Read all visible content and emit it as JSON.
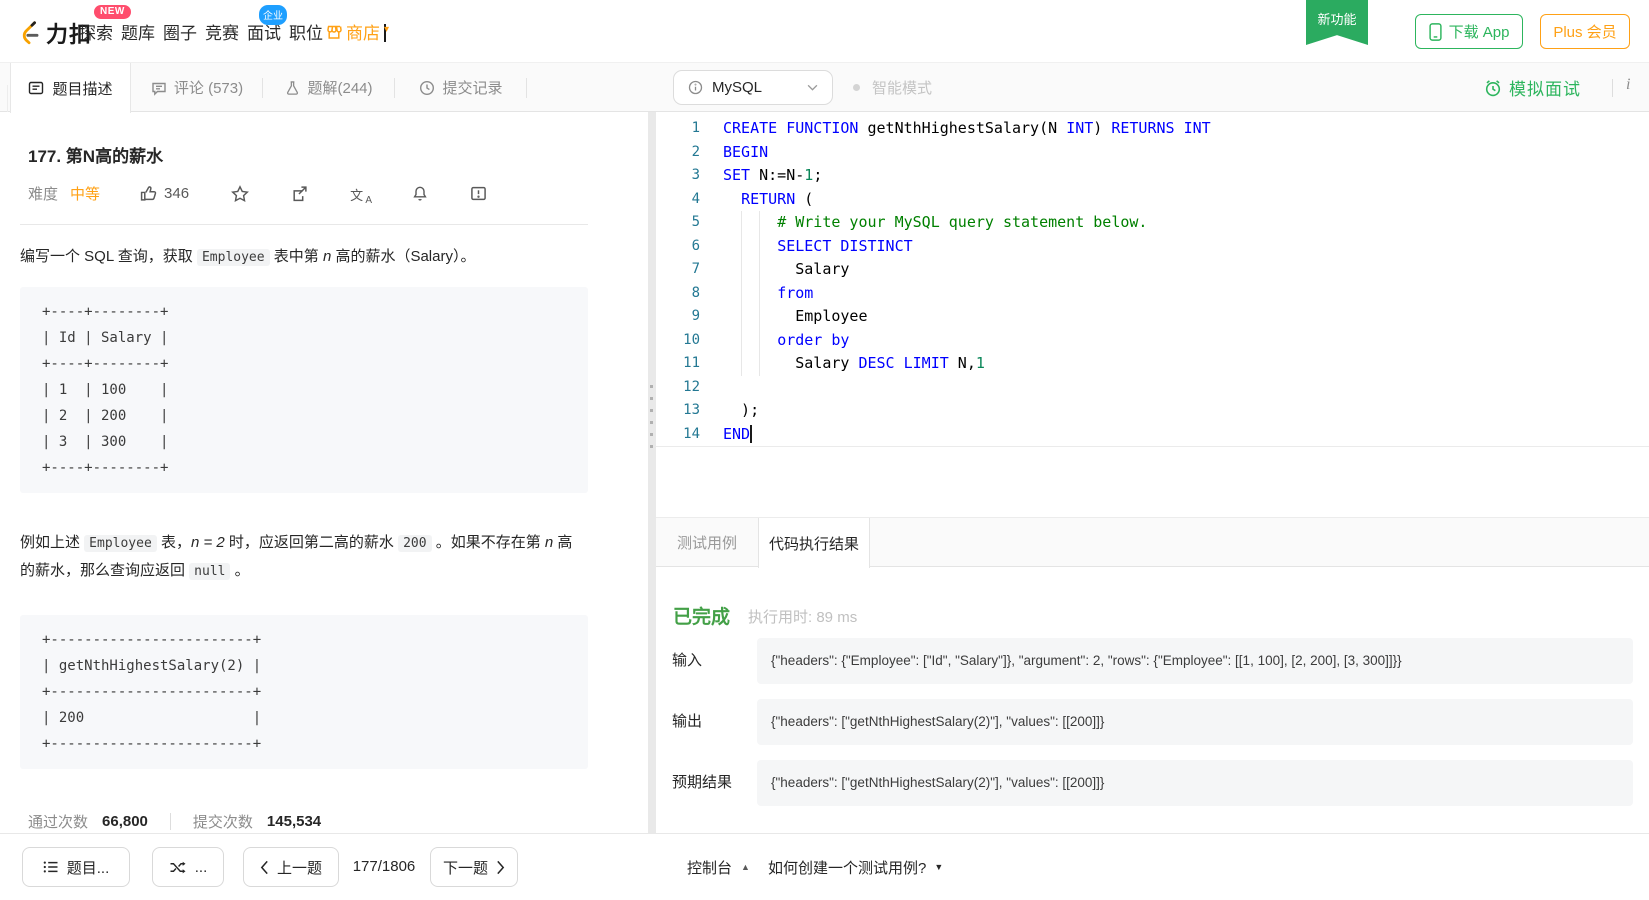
{
  "navbar": {
    "logo": "力扣",
    "items": [
      "探索",
      "题库",
      "圈子",
      "竞赛",
      "面试",
      "职位"
    ],
    "store": "商店",
    "new_badge": "NEW",
    "enterprise_badge": "企业",
    "ribbon": "新功能",
    "download_app": "下载 App",
    "plus_member": "Plus 会员"
  },
  "tabstrip": {
    "description_tab": "题目描述",
    "comments_tab": "评论 (573)",
    "solutions_tab": "题解(244)",
    "submissions_tab": "提交记录",
    "language": "MySQL",
    "smart_mode": "智能模式",
    "mock_interview": "模拟面试",
    "info_i": "i"
  },
  "problem": {
    "title": "177. 第N高的薪水",
    "difficulty_label": "难度",
    "difficulty": "中等",
    "likes": "346",
    "para1": [
      {
        "t": "编写一个 SQL 查询，获取 "
      },
      {
        "t": "Employee",
        "s": "code"
      },
      {
        "t": " 表中第 "
      },
      {
        "t": "n",
        "s": "i"
      },
      {
        "t": " 高的薪水（Salary）。"
      }
    ],
    "code_block1": [
      "+----+--------+",
      "| Id | Salary |",
      "+----+--------+",
      "| 1  | 100    |",
      "| 2  | 200    |",
      "| 3  | 300    |",
      "+----+--------+"
    ],
    "para2": [
      {
        "t": "例如上述 "
      },
      {
        "t": "Employee",
        "s": "code"
      },
      {
        "t": " 表，"
      },
      {
        "t": "n = 2",
        "s": "i"
      },
      {
        "t": " 时，应返回第二高的薪水 "
      },
      {
        "t": "200",
        "s": "code"
      },
      {
        "t": " 。如果不存在第 "
      },
      {
        "t": "n",
        "s": "i"
      },
      {
        "t": " 高的薪水，那么查询应返回 "
      },
      {
        "t": "null",
        "s": "code"
      },
      {
        "t": " 。"
      }
    ],
    "code_block2": [
      "+------------------------+",
      "| getNthHighestSalary(2) |",
      "+------------------------+",
      "| 200                    |",
      "+------------------------+"
    ],
    "accepted_label": "通过次数",
    "accepted": "66,800",
    "submitted_label": "提交次数",
    "submitted": "145,534"
  },
  "editor": {
    "lines": [
      {
        "n": 1,
        "segs": [
          {
            "t": "CREATE FUNCTION",
            "c": "k"
          },
          {
            "t": " getNthHighestSalary(N ",
            "c": "d"
          },
          {
            "t": "INT",
            "c": "k"
          },
          {
            "t": ") ",
            "c": "d"
          },
          {
            "t": "RETURNS INT",
            "c": "k"
          }
        ]
      },
      {
        "n": 2,
        "segs": [
          {
            "t": "BEGIN",
            "c": "k"
          }
        ]
      },
      {
        "n": 3,
        "segs": [
          {
            "t": "SET",
            "c": "k"
          },
          {
            "t": " N:=N-",
            "c": "d"
          },
          {
            "t": "1",
            "c": "n"
          },
          {
            "t": ";",
            "c": "d"
          }
        ]
      },
      {
        "n": 4,
        "segs": [
          {
            "t": "  ",
            "c": "d"
          },
          {
            "t": "RETURN",
            "c": "k"
          },
          {
            "t": " (",
            "c": "d"
          }
        ]
      },
      {
        "n": 5,
        "segs": [
          {
            "t": "      ",
            "c": "d"
          },
          {
            "t": "# Write your MySQL query statement below.",
            "c": "c"
          }
        ]
      },
      {
        "n": 6,
        "segs": [
          {
            "t": "      ",
            "c": "d"
          },
          {
            "t": "SELECT DISTINCT",
            "c": "k"
          }
        ]
      },
      {
        "n": 7,
        "segs": [
          {
            "t": "        Salary",
            "c": "d"
          }
        ]
      },
      {
        "n": 8,
        "segs": [
          {
            "t": "      ",
            "c": "d"
          },
          {
            "t": "from",
            "c": "k"
          }
        ]
      },
      {
        "n": 9,
        "segs": [
          {
            "t": "        Employee",
            "c": "d"
          }
        ]
      },
      {
        "n": 10,
        "segs": [
          {
            "t": "      ",
            "c": "d"
          },
          {
            "t": "order by",
            "c": "k"
          }
        ]
      },
      {
        "n": 11,
        "segs": [
          {
            "t": "        Salary ",
            "c": "d"
          },
          {
            "t": "DESC",
            "c": "k"
          },
          {
            "t": " ",
            "c": "d"
          },
          {
            "t": "LIMIT",
            "c": "k"
          },
          {
            "t": " N,",
            "c": "d"
          },
          {
            "t": "1",
            "c": "n"
          }
        ]
      },
      {
        "n": 12,
        "segs": []
      },
      {
        "n": 13,
        "segs": [
          {
            "t": "  );",
            "c": "d"
          }
        ]
      },
      {
        "n": 14,
        "segs": [
          {
            "t": "END",
            "c": "k"
          }
        ],
        "caret": true
      }
    ]
  },
  "results": {
    "testcase_tab": "测试用例",
    "result_tab": "代码执行结果",
    "status": "已完成",
    "runtime_label": "执行用时:",
    "runtime": "89 ms",
    "rows": [
      {
        "label": "输入",
        "value": "{\"headers\": {\"Employee\": [\"Id\", \"Salary\"]}, \"argument\": 2, \"rows\": {\"Employee\": [[1, 100], [2, 200], [3, 300]]}}"
      },
      {
        "label": "输出",
        "value": "{\"headers\": [\"getNthHighestSalary(2)\"], \"values\": [[200]]}"
      },
      {
        "label": "预期结果",
        "value": "{\"headers\": [\"getNthHighestSalary(2)\"], \"values\": [[200]]}"
      }
    ]
  },
  "bottombar": {
    "problem_list": "题目...",
    "shuffle": "...",
    "prev": "上一题",
    "counter": "177/1806",
    "next": "下一题",
    "console": "控制台",
    "howto": "如何创建一个测试用例?"
  },
  "colors": {
    "brand_green": "#2db55d",
    "brand_orange": "#ffa116",
    "keyword_blue": "#0000ff",
    "comment_green": "#008000",
    "number_green": "#098658",
    "line_number_teal": "#237893",
    "status_green": "#43a047"
  }
}
